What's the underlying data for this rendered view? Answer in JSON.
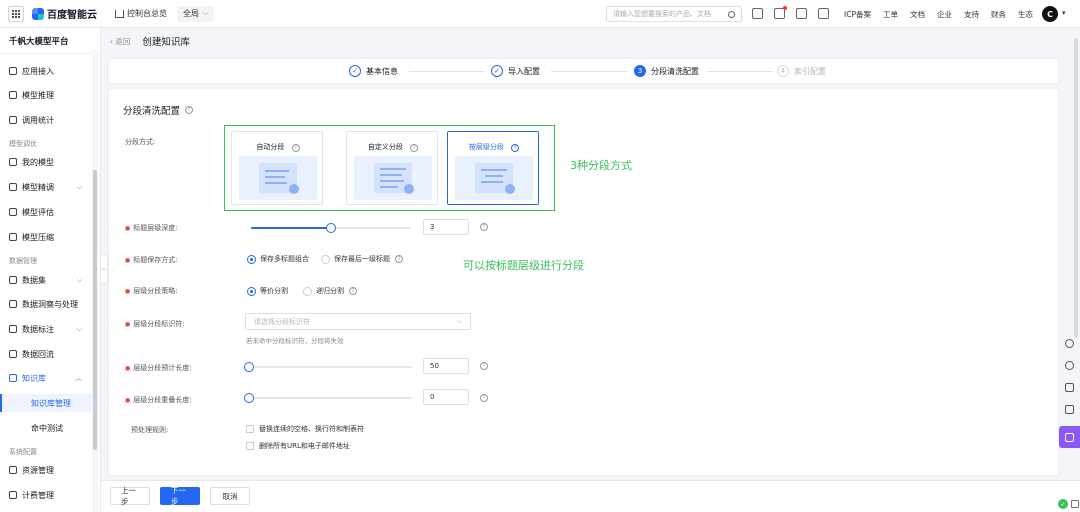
{
  "topbar": {
    "brand": "百度智能云",
    "console": "控制台总览",
    "region": "全局",
    "search_placeholder": "请输入您想要搜索的产品、文档",
    "links": [
      "ICP备案",
      "工单",
      "文档",
      "企业",
      "支持",
      "财务",
      "生态"
    ],
    "avatar": "C"
  },
  "sidebar": {
    "title": "千帆大模型平台",
    "items": [
      {
        "label": "应用接入",
        "icon": "app-icon"
      },
      {
        "label": "模型推理",
        "icon": "inference-icon"
      },
      {
        "label": "调用统计",
        "icon": "stats-icon"
      }
    ],
    "group_model_tuning": "模型调优",
    "tuning_items": [
      {
        "label": "我的模型",
        "icon": "model-icon"
      },
      {
        "label": "模型精调",
        "icon": "finetune-icon"
      },
      {
        "label": "模型评估",
        "icon": "evaluate-icon"
      },
      {
        "label": "模型压缩",
        "icon": "compress-icon"
      }
    ],
    "group_data": "数据管理",
    "data_items": [
      {
        "label": "数据集",
        "icon": "dataset-icon"
      },
      {
        "label": "数据洞察与处理",
        "icon": "insight-icon"
      },
      {
        "label": "数据标注",
        "icon": "annotate-icon"
      },
      {
        "label": "数据回流",
        "icon": "reflow-icon"
      },
      {
        "label": "知识库",
        "icon": "knowledge-icon"
      }
    ],
    "kb_sub": [
      "知识库管理",
      "命中测试"
    ],
    "group_system": "系统配置",
    "system_items": [
      {
        "label": "资源管理",
        "icon": "resource-icon"
      },
      {
        "label": "计费管理",
        "icon": "billing-icon"
      }
    ]
  },
  "breadcrumb": {
    "back": "返回",
    "title": "创建知识库"
  },
  "steps": [
    {
      "num": "",
      "label": "基本信息",
      "state": "done"
    },
    {
      "num": "",
      "label": "导入配置",
      "state": "done"
    },
    {
      "num": "3",
      "label": "分段清洗配置",
      "state": "current"
    },
    {
      "num": "4",
      "label": "索引配置",
      "state": "pending"
    }
  ],
  "form": {
    "section_title": "分段清洗配置",
    "seg_method_label": "分段方式:",
    "seg_options": [
      {
        "label": "自动分段"
      },
      {
        "label": "自定义分段"
      },
      {
        "label": "按层级分段",
        "selected": true
      }
    ],
    "annot_methods": "3种分段方式",
    "annot_level": "可以按标题层级进行分段",
    "heading_depth_label": "标题层级深度:",
    "heading_depth_value": "3",
    "heading_depth_fraction": 0.5,
    "save_mode_label": "标题保存方式:",
    "save_mode_options": [
      "保存多标题组合",
      "保存最后一级标题"
    ],
    "level_strategy_label": "层级分段策略:",
    "level_strategy_options": [
      "等价分割",
      "递归分割"
    ],
    "level_ident_label": "层级分段标识符:",
    "level_ident_placeholder": "请选择分段标识符",
    "level_ident_hint": "若未命中分段标识符，分段将失效",
    "expected_len_label": "层级分段预计长度:",
    "expected_len_value": "50",
    "overlap_len_label": "层级分段重叠长度:",
    "overlap_len_value": "0",
    "preprocess_label": "预处理规则:",
    "preprocess_options": [
      "替换连续的空格、换行符和制表符",
      "删除所有URL和电子邮件地址"
    ]
  },
  "bottom": {
    "prev": "上一步",
    "next": "下一步",
    "cancel": "取消"
  },
  "colors": {
    "primary": "#2468f2",
    "annotation_green": "#3ac05c",
    "tool_purple": "#8c58f2"
  }
}
